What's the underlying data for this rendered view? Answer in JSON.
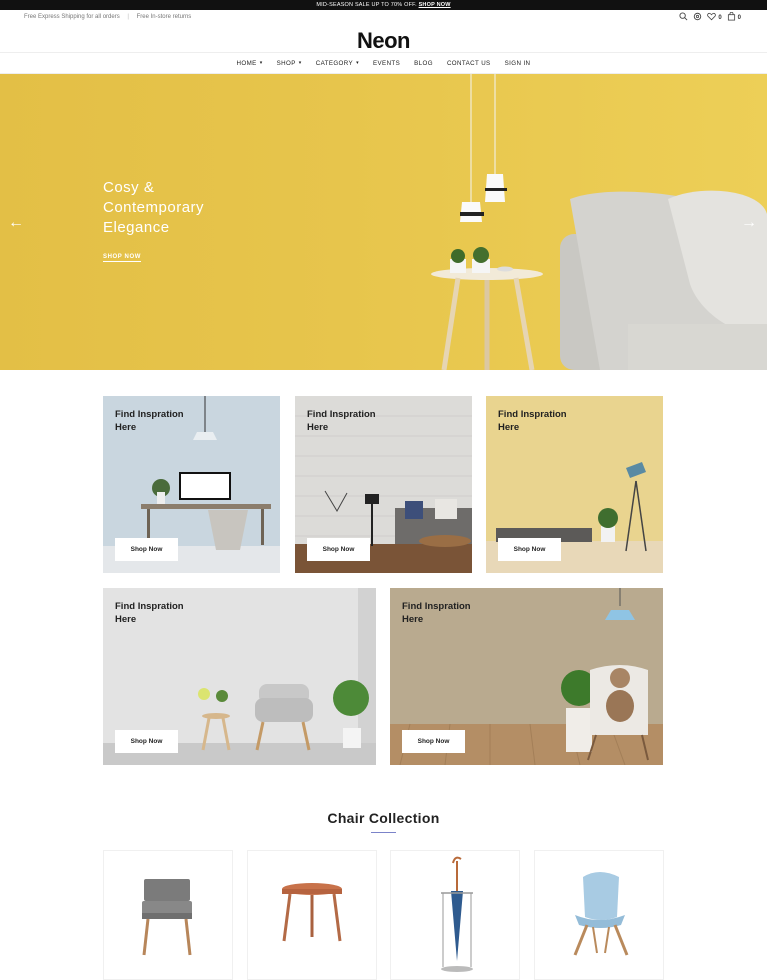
{
  "promo": {
    "text": "MID-SEASON SALE UP TO 70% OFF.",
    "link": "SHOP NOW"
  },
  "utility": {
    "shipping": "Free Express Shipping for all orders",
    "separator": "|",
    "returns": "Free In-store returns",
    "wishlist_count": "0",
    "cart_count": "0"
  },
  "brand": {
    "logo": "Neon"
  },
  "nav": {
    "items": [
      {
        "label": "HOME",
        "has_dropdown": true
      },
      {
        "label": "SHOP",
        "has_dropdown": true
      },
      {
        "label": "CATEGORY",
        "has_dropdown": true
      },
      {
        "label": "EVENTS",
        "has_dropdown": false
      },
      {
        "label": "BLOG",
        "has_dropdown": false
      },
      {
        "label": "CONTACT US",
        "has_dropdown": false
      },
      {
        "label": "SIGN IN",
        "has_dropdown": false
      }
    ]
  },
  "hero": {
    "title_line1": "Cosy &",
    "title_line2": "Contemporary",
    "title_line3": "Elegance",
    "cta": "SHOP NOW",
    "background": "#e5c34b"
  },
  "inspiration": {
    "cards": [
      {
        "title": "Find Inspration Here",
        "button": "Shop Now"
      },
      {
        "title": "Find Inspration Here",
        "button": "Shop Now"
      },
      {
        "title": "Find Inspration Here",
        "button": "Shop Now"
      },
      {
        "title": "Find Inspration Here",
        "button": "Shop Now"
      },
      {
        "title": "Find Inspration Here",
        "button": "Shop Now"
      }
    ]
  },
  "collection": {
    "title": "Chair Collection",
    "accent": "#7b83c9"
  },
  "icons": [
    "search-icon",
    "settings-icon",
    "heart-icon",
    "bag-icon",
    "arrow-left-icon",
    "arrow-right-icon"
  ]
}
